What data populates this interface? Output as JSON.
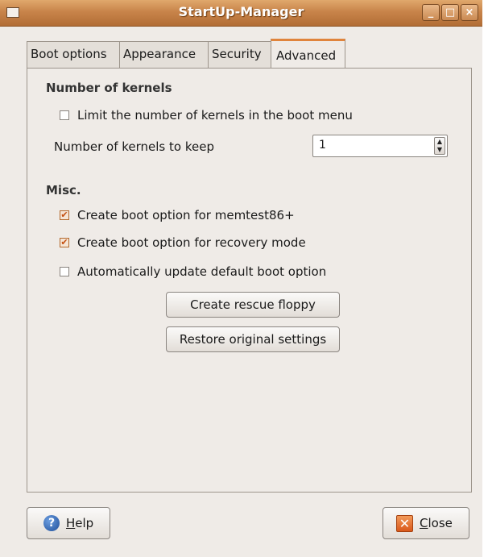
{
  "window": {
    "title": "StartUp-Manager"
  },
  "tabs": [
    {
      "label": "Boot options"
    },
    {
      "label": "Appearance"
    },
    {
      "label": "Security"
    },
    {
      "label": "Advanced",
      "active": true
    }
  ],
  "kernels": {
    "heading": "Number of kernels",
    "limit_checkbox": {
      "label": "Limit the number of kernels in the boot menu",
      "checked": false
    },
    "keep_label": "Number of kernels to keep",
    "keep_value": "1"
  },
  "misc": {
    "heading": "Misc.",
    "options": [
      {
        "label": "Create boot option for memtest86+",
        "checked": true
      },
      {
        "label": "Create boot option for recovery mode",
        "checked": true
      },
      {
        "label": "Automatically update default boot option",
        "checked": false
      }
    ],
    "rescue_button": "Create rescue floppy",
    "restore_button": "Restore original settings"
  },
  "footer": {
    "help_mnemonic": "H",
    "help_rest": "elp",
    "close_mnemonic": "C",
    "close_rest": "lose"
  },
  "colors": {
    "accent": "#e0843c",
    "titlebar": "#c8844a",
    "check": "#c44e0f"
  }
}
